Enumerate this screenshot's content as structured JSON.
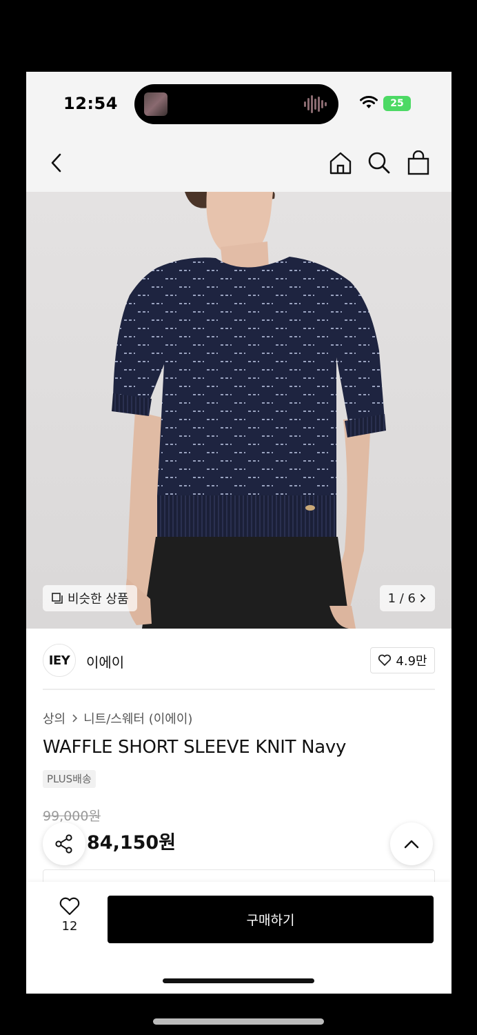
{
  "status_bar": {
    "time": "12:54",
    "battery": "25"
  },
  "nav": {
    "back_icon": "chevron-left-icon",
    "home_icon": "home-icon",
    "search_icon": "search-icon",
    "bag_icon": "shopping-bag-icon"
  },
  "hero": {
    "similar_label": "비슷한 상품",
    "page_current": "1",
    "page_total": "6",
    "page_text": "1 / 6"
  },
  "brand": {
    "logo_text": "IEY",
    "name": "이에이",
    "likes": "4.9만"
  },
  "breadcrumb": {
    "category": "상의",
    "subcategory": "니트/스웨터 (이에이)"
  },
  "product": {
    "title": "WAFFLE SHORT SLEEVE KNIT Navy",
    "delivery_badge": "PLUS배송",
    "price_original": "99,000원",
    "price_current": "84,150원"
  },
  "bottom_bar": {
    "wish_count": "12",
    "buy_label": "구매하기"
  },
  "colors": {
    "accent": "#000000",
    "battery": "#4cd964",
    "knit": "#1e2440"
  }
}
